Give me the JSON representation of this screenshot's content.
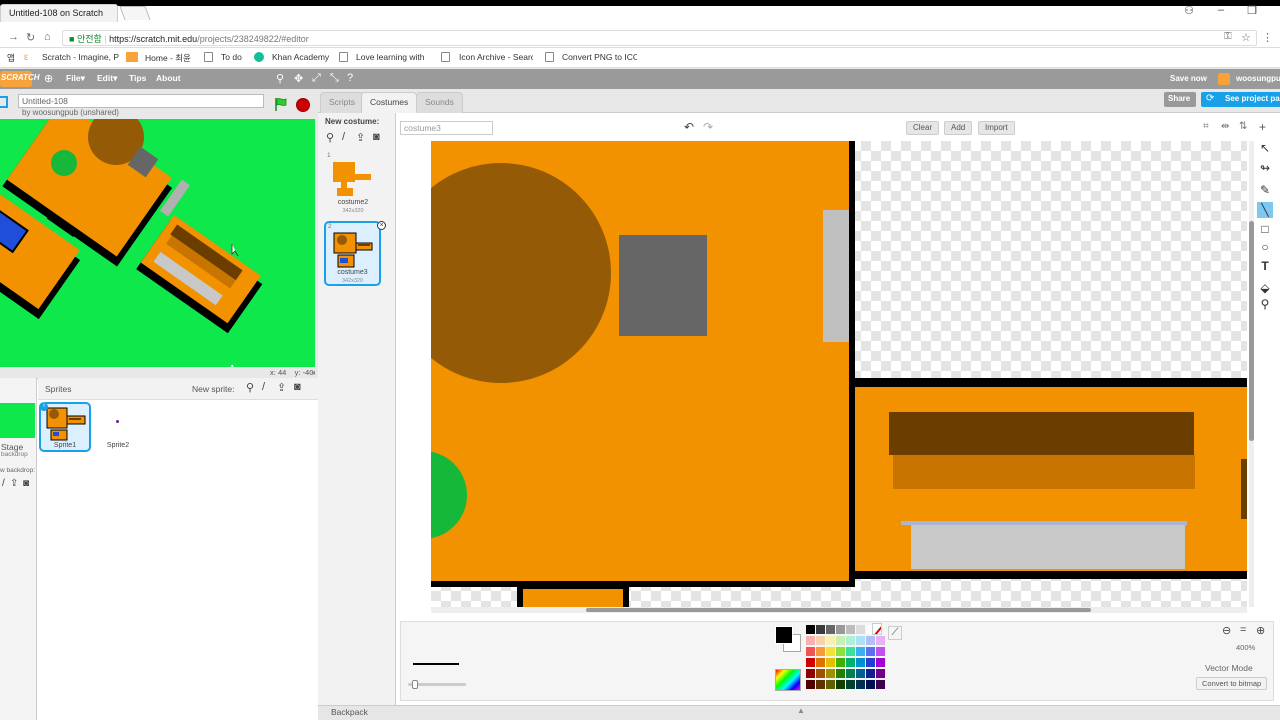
{
  "browser": {
    "tab_title": "Untitled-108 on Scratch",
    "url_secure_label": "안전함",
    "url_host": "https://scratch.mit.edu",
    "url_path": "/projects/238249822/#editor",
    "bookmarks": [
      "Scratch - Imagine, P",
      "Home - 최윤",
      "To do",
      "Khan Academy",
      "Love learning with",
      "Icon Archive - Searc",
      "Convert PNG to ICO"
    ],
    "bookmarks_prefix": "앱"
  },
  "scratch_menu": {
    "logo": "SCRATCH",
    "items": [
      "File",
      "Edit",
      "Tips",
      "About"
    ],
    "save_now": "Save now",
    "username": "woosungpub"
  },
  "project": {
    "title": "Untitled-108",
    "byline": "by woosungpub (unshared)",
    "share_label": "Share",
    "see_page_label": "See project pa"
  },
  "stage": {
    "x_label": "x:",
    "x_value": "44",
    "y_label": "y:",
    "y_value": "-40",
    "bg_color": "#0ee84a"
  },
  "sprites_pane": {
    "header": "Sprites",
    "new_sprite": "New sprite:",
    "stage_label": "Stage",
    "stage_sub": "backdrop",
    "new_backdrop": "w backdrop:",
    "sprites": [
      {
        "name": "Sprite1",
        "selected": true
      },
      {
        "name": "Sprite2",
        "selected": false
      }
    ]
  },
  "editor": {
    "tabs": [
      "Scripts",
      "Costumes",
      "Sounds"
    ],
    "active_tab": "Costumes",
    "new_costume": "New costume:",
    "costumes": [
      {
        "index": "1",
        "name": "costume2",
        "size": "342x320"
      },
      {
        "index": "2",
        "name": "costume3",
        "size": "342x320"
      }
    ],
    "costume_name_placeholder": "costume3",
    "buttons": {
      "clear": "Clear",
      "add": "Add",
      "import": "Import"
    },
    "zoom": "400%",
    "mode": "Vector Mode",
    "convert": "Convert to bitmap",
    "backpack": "Backpack"
  },
  "colors": {
    "orange": "#f39200",
    "brown": "#955a05",
    "dark_brown": "#6b3e00",
    "gray": "#666666",
    "light_gray": "#c8c8c8",
    "green": "#16b83a",
    "blue": "#1f4fd8",
    "accent": "#1aa0e6"
  },
  "palette": [
    "#000000",
    "#3a3a3a",
    "#666666",
    "#999999",
    "#bdbdbd",
    "#dcdcdc",
    "#ffffff",
    "#ffffff",
    "#f7b0b0",
    "#f7d0b0",
    "#f7f0b0",
    "#c8f0b0",
    "#b0f0d8",
    "#b0e0f7",
    "#b0c0f7",
    "#e8b0f7",
    "#ee5555",
    "#f59a3a",
    "#f5e03a",
    "#8ee03a",
    "#3ae0a0",
    "#3ab0f0",
    "#5a70f0",
    "#c050f0",
    "#d00000",
    "#e07000",
    "#e0c000",
    "#40b000",
    "#00b070",
    "#0090d0",
    "#2040d0",
    "#a000d0",
    "#900000",
    "#a05000",
    "#a09000",
    "#208000",
    "#008050",
    "#006090",
    "#102090",
    "#700090",
    "#500000",
    "#603000",
    "#606000",
    "#104000",
    "#004030",
    "#003050",
    "#001050",
    "#400050"
  ]
}
